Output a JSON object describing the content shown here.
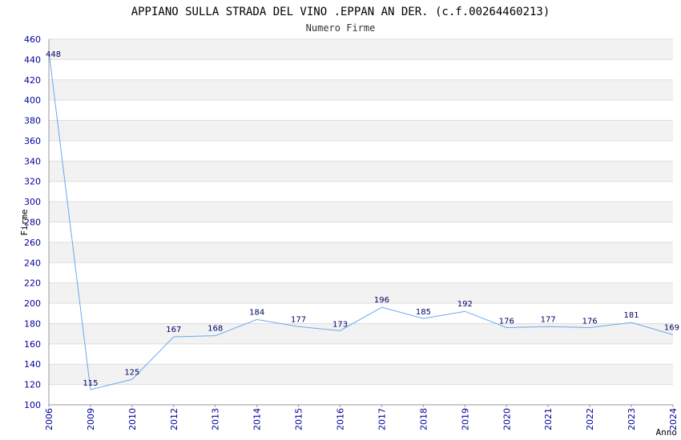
{
  "chart_data": {
    "type": "line",
    "title": "APPIANO SULLA STRADA DEL VINO .EPPAN AN DER. (c.f.00264460213)",
    "subtitle": "Numero Firme",
    "xlabel": "Anno",
    "ylabel": "Firme",
    "x": [
      "2006",
      "2009",
      "2010",
      "2012",
      "2013",
      "2014",
      "2015",
      "2016",
      "2017",
      "2018",
      "2019",
      "2020",
      "2021",
      "2022",
      "2023",
      "2024"
    ],
    "values": [
      448,
      115,
      125,
      167,
      168,
      184,
      177,
      173,
      196,
      185,
      192,
      176,
      177,
      176,
      181,
      169
    ],
    "ylim": [
      100,
      460
    ],
    "yticks": [
      100,
      120,
      140,
      160,
      180,
      200,
      220,
      240,
      260,
      280,
      300,
      320,
      340,
      360,
      380,
      400,
      420,
      440,
      460
    ],
    "grid": true,
    "colors": {
      "line": "#66aaee",
      "band": "#f2f2f2",
      "tick_text": "#000099",
      "label_text": "#000066"
    }
  }
}
